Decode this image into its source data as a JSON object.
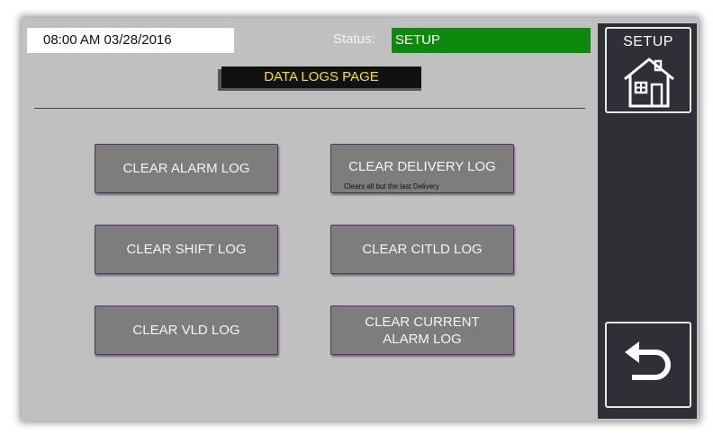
{
  "header": {
    "datetime": "08:00 AM 03/28/2016",
    "status_label": "Status:",
    "status_value": "SETUP",
    "page_title": "DATA LOGS PAGE"
  },
  "buttons": {
    "clear_alarm_log": "CLEAR ALARM LOG",
    "clear_delivery_log": "CLEAR DELIVERY LOG",
    "clear_delivery_log_note": "Clears all but the last Delivery",
    "clear_shift_log": "CLEAR SHIFT LOG",
    "clear_citld_log": "CLEAR CITLD LOG",
    "clear_vld_log": "CLEAR VLD LOG",
    "clear_current_alarm_log_line1": "CLEAR CURRENT",
    "clear_current_alarm_log_line2": "ALARM LOG"
  },
  "sidebar": {
    "setup_label": "SETUP",
    "setup_icon": "house-icon",
    "back_icon": "back-arrow-icon"
  },
  "colors": {
    "status_ok": "#0b8a0b",
    "title_text": "#f4e400",
    "panel_bg": "#c0c0c0",
    "sidebar_bg": "#2e3036"
  }
}
